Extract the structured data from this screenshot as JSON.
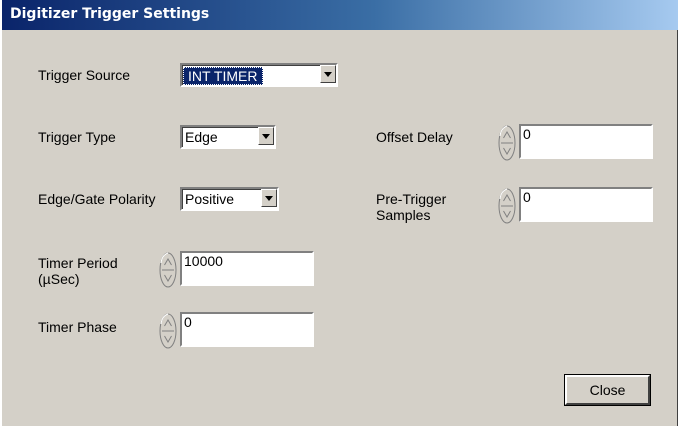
{
  "window": {
    "title": "Digitizer Trigger Settings"
  },
  "fields": {
    "trigger_source": {
      "label": "Trigger Source",
      "value": "INT TIMER"
    },
    "trigger_type": {
      "label": "Trigger Type",
      "value": "Edge"
    },
    "edge_gate_polarity": {
      "label": "Edge/Gate Polarity",
      "value": "Positive"
    },
    "timer_period": {
      "label_line1": "Timer Period",
      "label_line2": "(µSec)",
      "value": "10000"
    },
    "timer_phase": {
      "label": "Timer Phase",
      "value": "0"
    },
    "offset_delay": {
      "label": "Offset Delay",
      "value": "0"
    },
    "pre_trigger_samples": {
      "label_line1": "Pre-Trigger",
      "label_line2": "Samples",
      "value": "0"
    }
  },
  "buttons": {
    "close_label": "Close"
  },
  "icons": {
    "dropdown": "chevron-down-icon",
    "spinner": "increment-decrement-icon"
  },
  "colors": {
    "panel_bg": "#d4d0c8",
    "title_gradient_start": "#0a246a",
    "title_gradient_end": "#a6caf0",
    "selection": "#0a246a"
  }
}
